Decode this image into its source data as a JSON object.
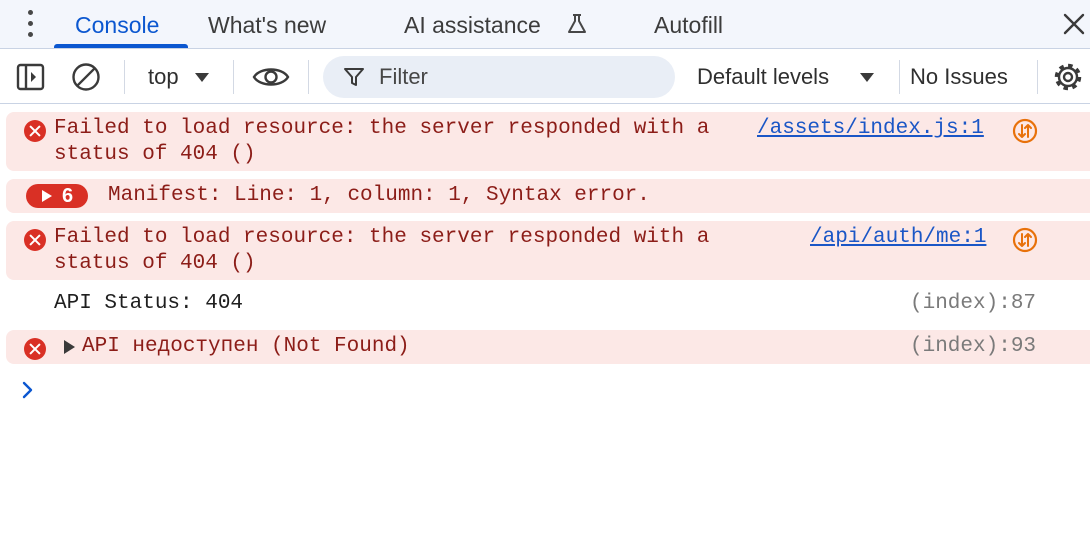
{
  "tabs": [
    {
      "label": "Console",
      "active": true
    },
    {
      "label": "What's new"
    },
    {
      "label": "AI assistance",
      "icon": "flask-icon"
    },
    {
      "label": "Autofill"
    }
  ],
  "toolbar": {
    "context": "top",
    "filter_placeholder": "Filter",
    "levels": "Default levels",
    "issues": "No Issues"
  },
  "messages": [
    {
      "level": "error",
      "text": "Failed to load resource: the server responded with a\nstatus of 404 ()",
      "source": "/assets/index.js:1"
    },
    {
      "level": "error-group",
      "count": "6",
      "text": "Manifest: Line: 1, column: 1, Syntax error."
    },
    {
      "level": "error",
      "text": "Failed to load resource: the server responded with a\nstatus of 404 ()",
      "source": "/api/auth/me:1"
    },
    {
      "level": "log",
      "text": "API Status: 404",
      "source": "(index):87"
    },
    {
      "level": "error",
      "text": "API недоступен (Not Found)",
      "source": "(index):93"
    }
  ],
  "colors": {
    "accent": "#0b57d0",
    "error_bg": "#fce8e6",
    "error_icon": "#d93025",
    "error_text": "#8c1d18",
    "link": "#1a56c6",
    "network_icon": "#e8710a"
  }
}
